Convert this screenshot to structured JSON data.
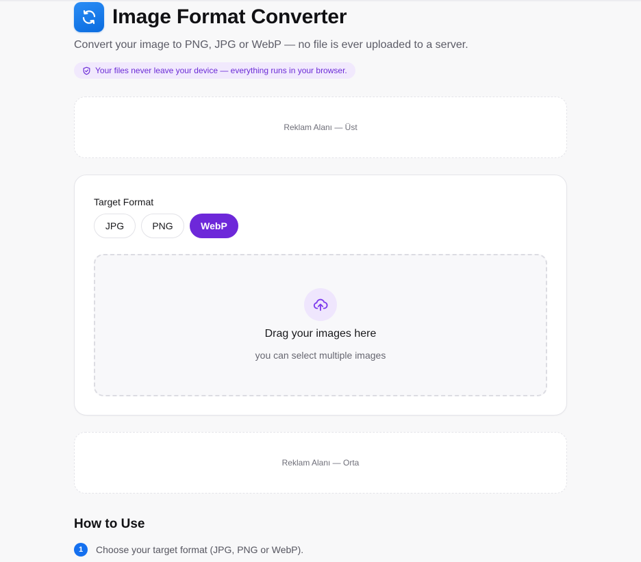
{
  "header": {
    "title": "Image Format Converter",
    "subtitle": "Convert your image to PNG, JPG or WebP — no file is ever uploaded to a server.",
    "icon": "refresh-icon",
    "icon_color": "#0a6bdf"
  },
  "privacy": {
    "text": "Your files never leave your device — everything runs in your browser.",
    "icon": "shield-check-icon",
    "color": "#6b2bd6"
  },
  "ads": {
    "top": "Reklam Alanı — Üst",
    "middle": "Reklam Alanı — Orta"
  },
  "converter": {
    "format_label": "Target Format",
    "formats": [
      "JPG",
      "PNG",
      "WebP"
    ],
    "selected_format": "WebP",
    "accent_color": "#6d28d9",
    "dropzone": {
      "icon": "cloud-upload-icon",
      "title": "Drag your images here",
      "subtitle": "you can select multiple images"
    }
  },
  "how_to": {
    "title": "How to Use",
    "steps": [
      {
        "number": "1",
        "text": "Choose your target format (JPG, PNG or WebP)."
      }
    ]
  }
}
